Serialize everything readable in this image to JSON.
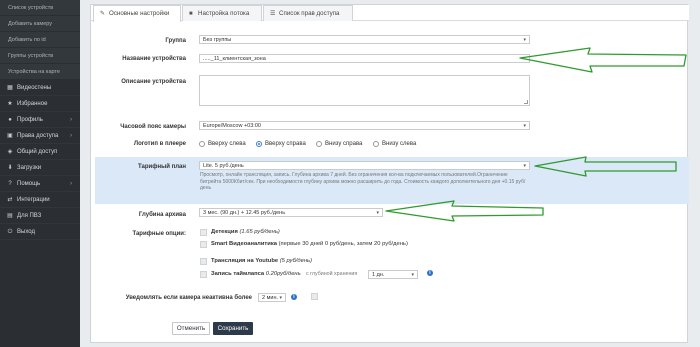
{
  "sidebar": {
    "sub_items": [
      "Список устройств",
      "Добавить камеру",
      "Добавить по id",
      "Группы устройств",
      "Устройства на карте"
    ],
    "items": [
      {
        "label": "Видеостены",
        "icon": "video-wall-icon",
        "glyph": "▦",
        "chevron": false
      },
      {
        "label": "Избранное",
        "icon": "star-icon",
        "glyph": "★",
        "chevron": false
      },
      {
        "label": "Профиль",
        "icon": "user-icon",
        "glyph": "●",
        "chevron": true
      },
      {
        "label": "Права доступа",
        "icon": "lock-icon",
        "glyph": "▣",
        "chevron": true
      },
      {
        "label": "Общий доступ",
        "icon": "share-icon",
        "glyph": "◈",
        "chevron": false
      },
      {
        "label": "Загрузки",
        "icon": "download-icon",
        "glyph": "⬇",
        "chevron": false
      },
      {
        "label": "Помощь",
        "icon": "help-icon",
        "glyph": "?",
        "chevron": true
      },
      {
        "label": "Интеграции",
        "icon": "integrations-icon",
        "glyph": "⇄",
        "chevron": false
      },
      {
        "label": "Для ПВЗ",
        "icon": "document-icon",
        "glyph": "▤",
        "chevron": false
      },
      {
        "label": "Выход",
        "icon": "logout-icon",
        "glyph": "⏻",
        "chevron": false
      }
    ]
  },
  "tabs": [
    {
      "label": "Основные настройки",
      "icon": "edit-icon",
      "glyph": "✎"
    },
    {
      "label": "Настройка потока",
      "icon": "camera-icon",
      "glyph": "■"
    },
    {
      "label": "Список прав доступа",
      "icon": "list-icon",
      "glyph": "☰"
    }
  ],
  "form": {
    "group_label": "Группа",
    "group_value": "Без группы",
    "device_name_label": "Название устройства",
    "device_name_value": "....._11_клиентская_зона",
    "description_label": "Описание устройства",
    "timezone_label": "Часовой пояс камеры",
    "timezone_value": "Europe/Moscow +03:00",
    "logo_label": "Логотип в плеере",
    "logo_options": [
      "Вверху слева",
      "Вверху справа",
      "Внизу справа",
      "Внизу слева"
    ],
    "logo_selected": 1,
    "tariff_label": "Тарифный план",
    "tariff_value": "Lite. 5 руб./день",
    "tariff_note": "Просмотр, онлайн трансляция, запись. Глубина архива 7 дней. Без ограничения кол-ва подключаемых пользователей.Ограничение битрейта 5000Кбит/сек. При необходимости глубину архива можно расширить до года. Стоимость каждого дополнительного дня +0.15 руб/день",
    "archive_label": "Глубина архива",
    "archive_value": "3 мес. (90 дн.) + 12.45 руб./день",
    "options_label": "Тарифные опции:",
    "options": {
      "detection_name": "Детекция",
      "detection_price": "(1.65 руб/день)",
      "smart_name": "Smart Видеоаналитика",
      "smart_price": "(первые 30 дней 0 руб/день, затем 20 руб/день)",
      "youtube_name": "Трансляция на Youtube",
      "youtube_price": "(5 руб/день)",
      "timelapse_name": "Запись таймлапса",
      "timelapse_price": "0.20руб/день",
      "timelapse_depth_label": "с глубиной хранения",
      "timelapse_depth_value": "1 дн."
    },
    "notify_label": "Уведомлять если камера неактивна более",
    "notify_value": "2 мин."
  },
  "buttons": {
    "cancel": "Отменить",
    "save": "Сохранить"
  },
  "colors": {
    "sidebar_bg": "#2b2f33",
    "highlight_bg": "#dbe8f7",
    "arrow": "#2e9b2e",
    "save_bg": "#2d3a4a",
    "info": "#2f6fca"
  }
}
